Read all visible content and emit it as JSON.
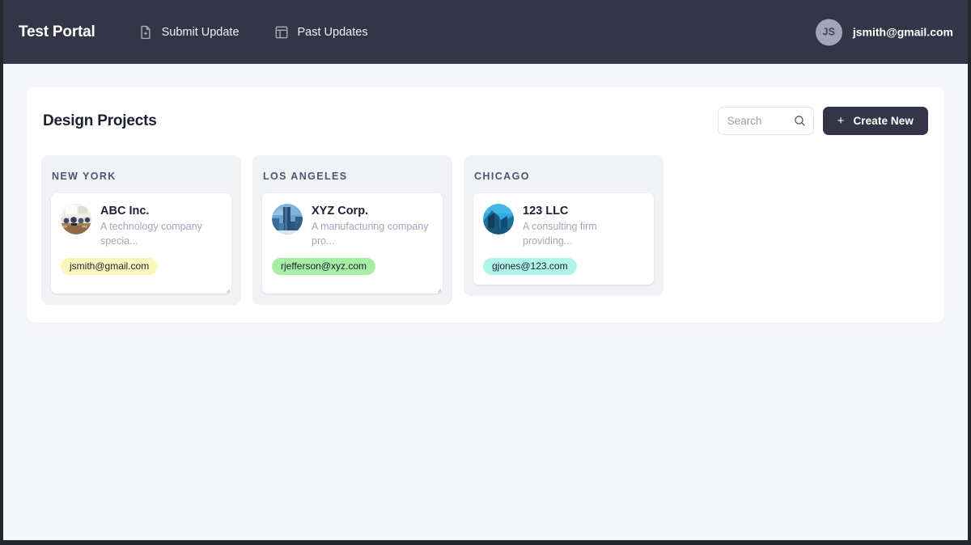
{
  "navbar": {
    "brand": "Test Portal",
    "links": [
      {
        "label": "Submit Update",
        "icon": "file-plus-icon"
      },
      {
        "label": "Past Updates",
        "icon": "layout-table-icon"
      }
    ],
    "user": {
      "initials": "JS",
      "email": "jsmith@gmail.com"
    }
  },
  "panel": {
    "title": "Design Projects",
    "search": {
      "placeholder": "Search",
      "value": "",
      "icon": "search-icon"
    },
    "create_button": {
      "label": "Create New",
      "plus": "+"
    }
  },
  "colors": {
    "navbar_bg": "#343547",
    "page_bg": "#f6f7fb",
    "panel_bg": "#ffffff",
    "column_bg": "#f1f2f6",
    "accent_button": "#343547",
    "tag_yellow": "#fbf7bc",
    "tag_green": "#a7eea5",
    "tag_cyan": "#b0f5ea"
  },
  "board": {
    "columns": [
      {
        "title": "NEW YORK",
        "cards": [
          {
            "name": "ABC Inc.",
            "description": "A technology company specia...",
            "tag": "jsmith@gmail.com",
            "tag_color": "#fbf7bc",
            "thumb": "office-meeting-photo"
          }
        ]
      },
      {
        "title": "LOS ANGELES",
        "cards": [
          {
            "name": "XYZ Corp.",
            "description": "A manufacturing company pro...",
            "tag": "rjefferson@xyz.com",
            "tag_color": "#a7eea5",
            "thumb": "blue-skyscraper-photo"
          }
        ]
      },
      {
        "title": "CHICAGO",
        "cards": [
          {
            "name": "123 LLC",
            "description": "A consulting firm providing...",
            "tag": "gjones@123.com",
            "tag_color": "#b0f5ea",
            "thumb": "city-tower-photo"
          }
        ]
      }
    ]
  }
}
